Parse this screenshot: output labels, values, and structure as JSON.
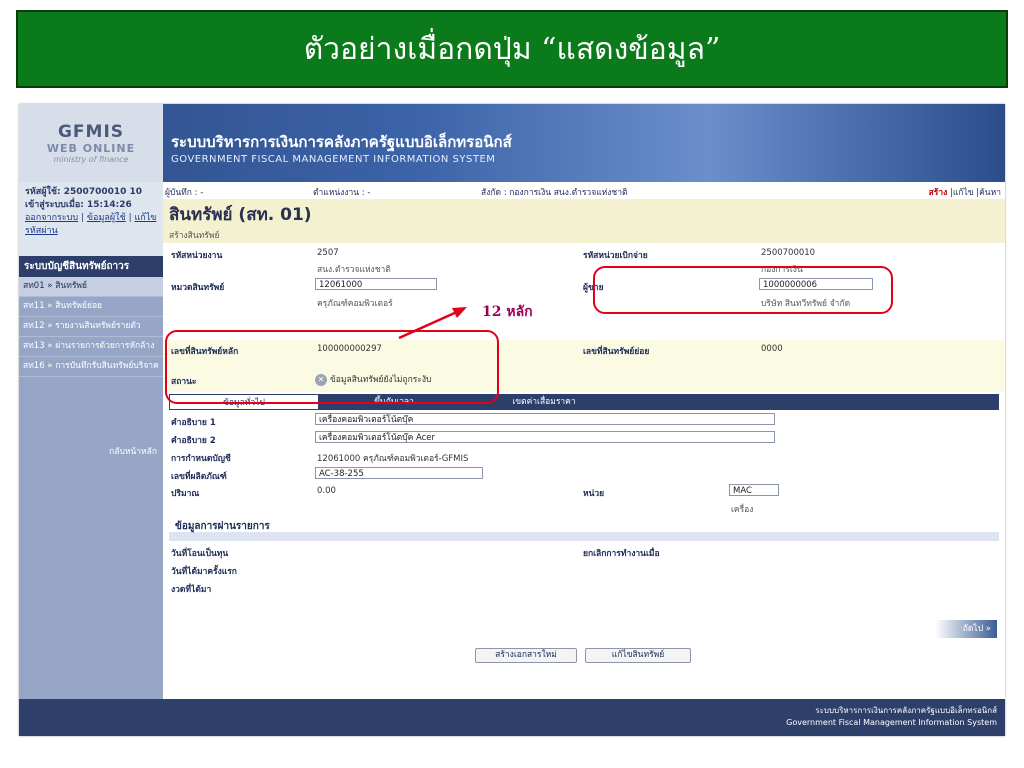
{
  "banner": {
    "title": "ตัวอย่างเมื่อกดปุ่ม “แสดงข้อมูล”"
  },
  "header": {
    "logo_line1": "GFMIS",
    "logo_line2": "WEB ONLINE",
    "logo_line3": "ministry of finance",
    "system_th": "ระบบบริหารการเงินการคลังภาครัฐแบบอิเล็กทรอนิกส์",
    "system_en": "GOVERNMENT FISCAL MANAGEMENT INFORMATION SYSTEM"
  },
  "user": {
    "id_line": "รหัสผู้ใช้: 2500700010 10",
    "login_line": "เข้าสู่ระบบเมื่อ: 15:14:26",
    "logout_link": "ออกจากระบบ",
    "userinfo_link": "ข้อมูลผู้ใช้",
    "changepw_link": "แก้ไขรหัสผ่าน"
  },
  "sidebar": {
    "header": "ระบบบัญชีสินทรัพย์ถาวร",
    "items": [
      {
        "label": "สท01 » สินทรัพย์"
      },
      {
        "label": "สท11 » สินทรัพย์ย่อย"
      },
      {
        "label": "สท12 » รายงานสินทรัพย์รายตัว"
      },
      {
        "label": "สท13 » ผ่านรายการด้วยการหักล้าง"
      },
      {
        "label": "สท16 » การบันทึกรับสินทรัพย์บริจาค"
      }
    ],
    "back_home": "กลับหน้าหลัก"
  },
  "topinfo": {
    "recorder": "ผู้บันทึก : -",
    "position": "ตำแหน่งงาน : -",
    "affiliation": "สังกัด : กองการเงิน สนง.ตำรวจแห่งชาติ",
    "link_create": "สร้าง",
    "link_edit": "|แก้ไข",
    "link_search": "|ค้นหา"
  },
  "page": {
    "title": "สินทรัพย์ (สท. 01)",
    "subtitle": "สร้างสินทรัพย์"
  },
  "form": {
    "unit_code_label": "รหัสหน่วยงาน",
    "unit_code_value": "2507",
    "unit_code_sub": "สนง.ตำรวจแห่งชาติ",
    "disb_code_label": "รหัสหน่วยเบิกจ่าย",
    "disb_code_value": "2500700010",
    "disb_code_sub": "กองการเงิน",
    "category_label": "หมวดสินทรัพย์",
    "category_value": "12061000",
    "category_sub": "ครุภัณฑ์คอมพิวเตอร์",
    "seller_label": "ผู้ขาย",
    "seller_value": "1000000006",
    "seller_sub": "บริษัท สินทวีทรัพย์ จำกัด",
    "main_asset_label": "เลขที่สินทรัพย์หลัก",
    "main_asset_value": "100000000297",
    "sub_asset_label": "เลขที่สินทรัพย์ย่อย",
    "sub_asset_value": "0000",
    "status_label": "สถานะ",
    "status_value": "ข้อมูลสินทรัพย์ยังไม่ถูกระงับ"
  },
  "tabs": [
    {
      "label": "ข้อมูลทั่วไป"
    },
    {
      "label": "ขึ้นกับเวลา"
    },
    {
      "label": "เขตค่าเสื่อมราคา"
    }
  ],
  "general": {
    "desc1_label": "คำอธิบาย 1",
    "desc1_value": "เครื่องคอมพิวเตอร์โน้ตบุ๊ค",
    "desc2_label": "คำอธิบาย 2",
    "desc2_value": "เครื่องคอมพิวเตอร์โน้ตบุ๊ค Acer",
    "account_label": "การกำหนดบัญชี",
    "account_value": "12061000 ครุภัณฑ์คอมพิวเตอร์-GFMIS",
    "product_label": "เลขที่ผลิตภัณฑ์",
    "product_value": "AC-38-255",
    "qty_label": "ปริมาณ",
    "qty_value": "0.00",
    "unit_label": "หน่วย",
    "unit_value": "MAC",
    "unit_sub": "เครื่อง"
  },
  "posting": {
    "header": "ข้อมูลการผ่านรายการ",
    "cap_date_label": "วันที่โอนเป็นทุน",
    "deactivate_label": "ยกเลิกการทำงานเมื่อ",
    "first_acq_label": "วันที่ได้มาครั้งแรก",
    "acq_period_label": "งวดที่ได้มา"
  },
  "buttons": {
    "next": "ถัดไป »",
    "new_doc": "สร้างเอกสารใหม่",
    "edit_asset": "แก้ไขสินทรัพย์"
  },
  "footer": {
    "line_th": "ระบบบริหารการเงินการคลังภาครัฐแบบอิเล็กทรอนิกส์",
    "line_en": "Government Fiscal Management Information System"
  },
  "annotation": {
    "label": "12 หลัก"
  },
  "colors": {
    "banner": "#0b7a1a",
    "highlight": "#e3001b",
    "annotation": "#9b0059",
    "nav": "#2c3f6b"
  }
}
